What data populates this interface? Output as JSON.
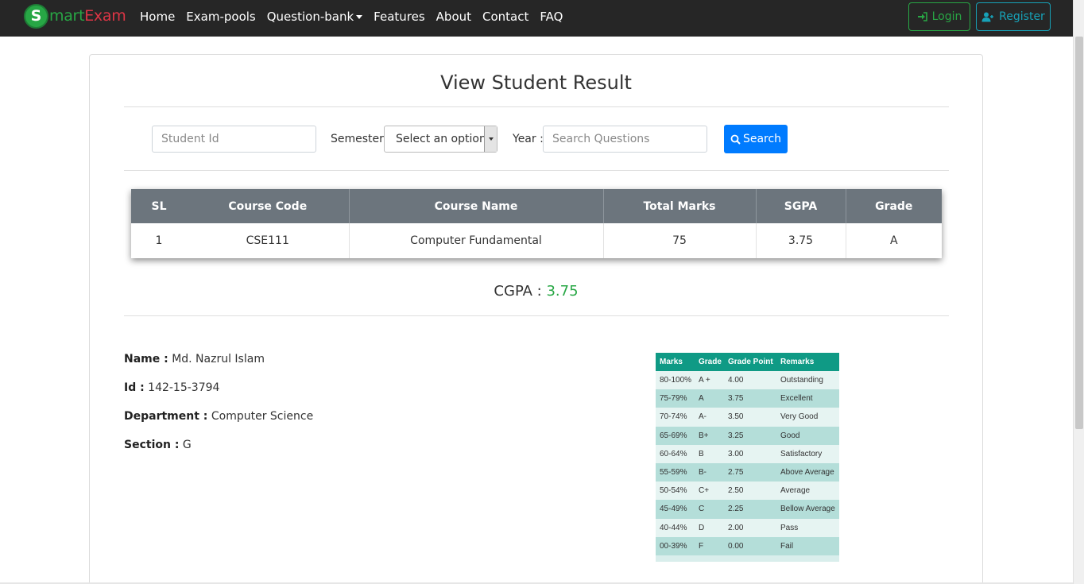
{
  "brand": {
    "letter": "S",
    "mart": "mart",
    "exam": "Exam"
  },
  "nav": {
    "links": [
      "Home",
      "Exam-pools",
      "Question-bank",
      "Features",
      "About",
      "Contact",
      "FAQ"
    ],
    "login_label": "Login",
    "register_label": "Register"
  },
  "page": {
    "title": "View Student Result"
  },
  "filters": {
    "student_id_placeholder": "Student Id",
    "semester_label": "Semester :",
    "semester_selected": "Select an option",
    "year_label": "Year :",
    "year_placeholder": "Search Questions",
    "search_label": "Search"
  },
  "results": {
    "headers": [
      "SL",
      "Course Code",
      "Course Name",
      "Total Marks",
      "SGPA",
      "Grade"
    ],
    "rows": [
      [
        "1",
        "CSE111",
        "Computer Fundamental",
        "75",
        "3.75",
        "A"
      ]
    ]
  },
  "cgpa": {
    "label": "CGPA :",
    "value": "3.75"
  },
  "student": {
    "name_label": "Name :",
    "name": "Md. Nazrul Islam",
    "id_label": "Id :",
    "id": "142-15-3794",
    "department_label": "Department :",
    "department": "Computer Science",
    "section_label": "Section :",
    "section": "G"
  },
  "grade_table": {
    "headers": [
      "Marks",
      "Grade",
      "Grade Point",
      "Remarks"
    ],
    "rows": [
      [
        "80-100%",
        "A +",
        "4.00",
        "Outstanding"
      ],
      [
        "75-79%",
        "A",
        "3.75",
        "Excellent"
      ],
      [
        "70-74%",
        "A-",
        "3.50",
        "Very Good"
      ],
      [
        "65-69%",
        "B+",
        "3.25",
        "Good"
      ],
      [
        "60-64%",
        "B",
        "3.00",
        "Satisfactory"
      ],
      [
        "55-59%",
        "B-",
        "2.75",
        "Above Average"
      ],
      [
        "50-54%",
        "C+",
        "2.50",
        "Average"
      ],
      [
        "45-49%",
        "C",
        "2.25",
        "Bellow Average"
      ],
      [
        "40-44%",
        "D",
        "2.00",
        "Pass"
      ],
      [
        "00-39%",
        "F",
        "0.00",
        "Fail"
      ]
    ]
  },
  "colors": {
    "navbar": "#262626",
    "success": "#28a745",
    "info": "#17a2b8",
    "primary": "#007bff",
    "table_header": "#6c757d",
    "grade_header": "#0f9a85"
  }
}
